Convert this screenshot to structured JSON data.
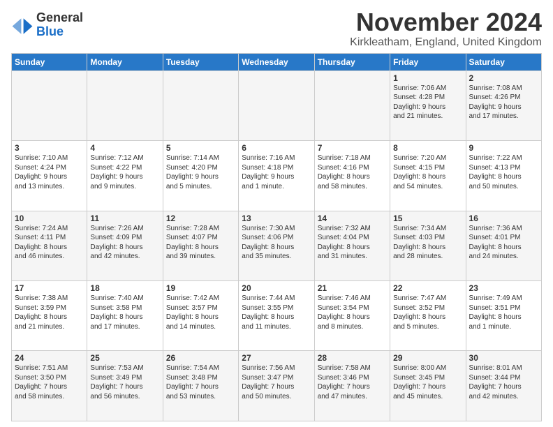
{
  "logo": {
    "line1": "General",
    "line2": "Blue"
  },
  "title": "November 2024",
  "location": "Kirkleatham, England, United Kingdom",
  "headers": [
    "Sunday",
    "Monday",
    "Tuesday",
    "Wednesday",
    "Thursday",
    "Friday",
    "Saturday"
  ],
  "weeks": [
    [
      {
        "day": "",
        "text": ""
      },
      {
        "day": "",
        "text": ""
      },
      {
        "day": "",
        "text": ""
      },
      {
        "day": "",
        "text": ""
      },
      {
        "day": "",
        "text": ""
      },
      {
        "day": "1",
        "text": "Sunrise: 7:06 AM\nSunset: 4:28 PM\nDaylight: 9 hours\nand 21 minutes."
      },
      {
        "day": "2",
        "text": "Sunrise: 7:08 AM\nSunset: 4:26 PM\nDaylight: 9 hours\nand 17 minutes."
      }
    ],
    [
      {
        "day": "3",
        "text": "Sunrise: 7:10 AM\nSunset: 4:24 PM\nDaylight: 9 hours\nand 13 minutes."
      },
      {
        "day": "4",
        "text": "Sunrise: 7:12 AM\nSunset: 4:22 PM\nDaylight: 9 hours\nand 9 minutes."
      },
      {
        "day": "5",
        "text": "Sunrise: 7:14 AM\nSunset: 4:20 PM\nDaylight: 9 hours\nand 5 minutes."
      },
      {
        "day": "6",
        "text": "Sunrise: 7:16 AM\nSunset: 4:18 PM\nDaylight: 9 hours\nand 1 minute."
      },
      {
        "day": "7",
        "text": "Sunrise: 7:18 AM\nSunset: 4:16 PM\nDaylight: 8 hours\nand 58 minutes."
      },
      {
        "day": "8",
        "text": "Sunrise: 7:20 AM\nSunset: 4:15 PM\nDaylight: 8 hours\nand 54 minutes."
      },
      {
        "day": "9",
        "text": "Sunrise: 7:22 AM\nSunset: 4:13 PM\nDaylight: 8 hours\nand 50 minutes."
      }
    ],
    [
      {
        "day": "10",
        "text": "Sunrise: 7:24 AM\nSunset: 4:11 PM\nDaylight: 8 hours\nand 46 minutes."
      },
      {
        "day": "11",
        "text": "Sunrise: 7:26 AM\nSunset: 4:09 PM\nDaylight: 8 hours\nand 42 minutes."
      },
      {
        "day": "12",
        "text": "Sunrise: 7:28 AM\nSunset: 4:07 PM\nDaylight: 8 hours\nand 39 minutes."
      },
      {
        "day": "13",
        "text": "Sunrise: 7:30 AM\nSunset: 4:06 PM\nDaylight: 8 hours\nand 35 minutes."
      },
      {
        "day": "14",
        "text": "Sunrise: 7:32 AM\nSunset: 4:04 PM\nDaylight: 8 hours\nand 31 minutes."
      },
      {
        "day": "15",
        "text": "Sunrise: 7:34 AM\nSunset: 4:03 PM\nDaylight: 8 hours\nand 28 minutes."
      },
      {
        "day": "16",
        "text": "Sunrise: 7:36 AM\nSunset: 4:01 PM\nDaylight: 8 hours\nand 24 minutes."
      }
    ],
    [
      {
        "day": "17",
        "text": "Sunrise: 7:38 AM\nSunset: 3:59 PM\nDaylight: 8 hours\nand 21 minutes."
      },
      {
        "day": "18",
        "text": "Sunrise: 7:40 AM\nSunset: 3:58 PM\nDaylight: 8 hours\nand 17 minutes."
      },
      {
        "day": "19",
        "text": "Sunrise: 7:42 AM\nSunset: 3:57 PM\nDaylight: 8 hours\nand 14 minutes."
      },
      {
        "day": "20",
        "text": "Sunrise: 7:44 AM\nSunset: 3:55 PM\nDaylight: 8 hours\nand 11 minutes."
      },
      {
        "day": "21",
        "text": "Sunrise: 7:46 AM\nSunset: 3:54 PM\nDaylight: 8 hours\nand 8 minutes."
      },
      {
        "day": "22",
        "text": "Sunrise: 7:47 AM\nSunset: 3:52 PM\nDaylight: 8 hours\nand 5 minutes."
      },
      {
        "day": "23",
        "text": "Sunrise: 7:49 AM\nSunset: 3:51 PM\nDaylight: 8 hours\nand 1 minute."
      }
    ],
    [
      {
        "day": "24",
        "text": "Sunrise: 7:51 AM\nSunset: 3:50 PM\nDaylight: 7 hours\nand 58 minutes."
      },
      {
        "day": "25",
        "text": "Sunrise: 7:53 AM\nSunset: 3:49 PM\nDaylight: 7 hours\nand 56 minutes."
      },
      {
        "day": "26",
        "text": "Sunrise: 7:54 AM\nSunset: 3:48 PM\nDaylight: 7 hours\nand 53 minutes."
      },
      {
        "day": "27",
        "text": "Sunrise: 7:56 AM\nSunset: 3:47 PM\nDaylight: 7 hours\nand 50 minutes."
      },
      {
        "day": "28",
        "text": "Sunrise: 7:58 AM\nSunset: 3:46 PM\nDaylight: 7 hours\nand 47 minutes."
      },
      {
        "day": "29",
        "text": "Sunrise: 8:00 AM\nSunset: 3:45 PM\nDaylight: 7 hours\nand 45 minutes."
      },
      {
        "day": "30",
        "text": "Sunrise: 8:01 AM\nSunset: 3:44 PM\nDaylight: 7 hours\nand 42 minutes."
      }
    ]
  ]
}
